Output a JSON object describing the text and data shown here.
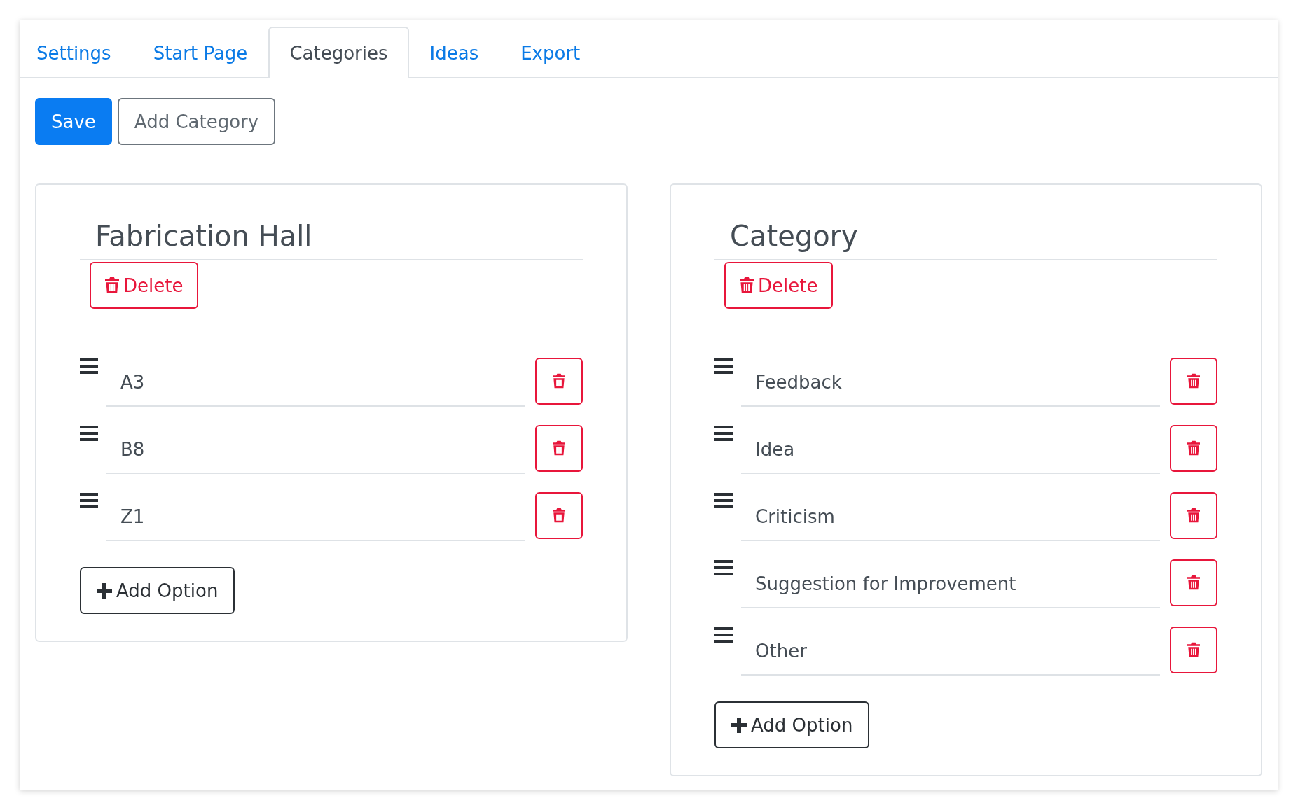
{
  "tabs": [
    {
      "label": "Settings",
      "selected": false
    },
    {
      "label": "Start Page",
      "selected": false
    },
    {
      "label": "Categories",
      "selected": true
    },
    {
      "label": "Ideas",
      "selected": false
    },
    {
      "label": "Export",
      "selected": false
    }
  ],
  "toolbar": {
    "save": "Save",
    "add_category": "Add Category"
  },
  "categories": [
    {
      "name": "Fabrication Hall",
      "delete": "Delete",
      "options": [
        "A3",
        "B8",
        "Z1"
      ],
      "add_option": "Add Option"
    },
    {
      "name": "Category",
      "delete": "Delete",
      "options": [
        "Feedback",
        "Idea",
        "Criticism",
        "Suggestion for Improvement",
        "Other"
      ],
      "add_option": "Add Option"
    }
  ]
}
